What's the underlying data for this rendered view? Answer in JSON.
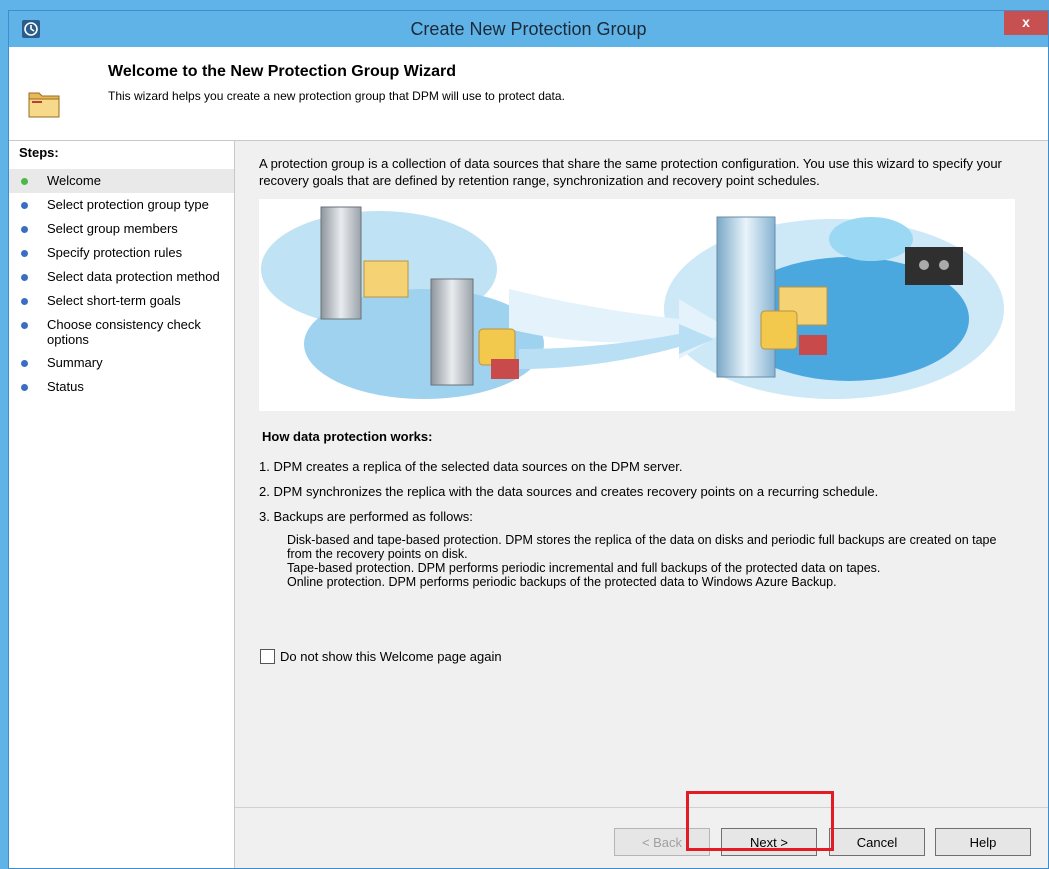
{
  "window": {
    "title": "Create New Protection Group",
    "close_label": "x"
  },
  "header": {
    "title": "Welcome to the New Protection Group Wizard",
    "subtitle": "This wizard helps you create a new protection group that DPM will use to protect data."
  },
  "sidebar": {
    "title": "Steps:",
    "items": [
      {
        "label": "Welcome"
      },
      {
        "label": "Select protection group type"
      },
      {
        "label": "Select group members"
      },
      {
        "label": "Specify protection rules"
      },
      {
        "label": "Select data protection method"
      },
      {
        "label": "Select short-term goals"
      },
      {
        "label": "Choose consistency check options"
      },
      {
        "label": "Summary"
      },
      {
        "label": "Status"
      }
    ],
    "active_index": 0
  },
  "main": {
    "intro": "A protection group is a collection of data sources that share the same protection configuration. You use this wizard to specify your recovery goals that are defined by retention range, synchronization and recovery point schedules.",
    "how_title": "How data protection works:",
    "how_items": [
      "1.  DPM creates a replica of the selected data sources on the DPM server.",
      "2.  DPM synchronizes the replica with the data sources and creates recovery points on a recurring schedule.",
      "3.  Backups are performed as follows:"
    ],
    "backup_details": [
      "Disk-based and tape-based protection. DPM stores the replica of the data on disks and periodic full backups are created on tape from the recovery points on disk.",
      "Tape-based protection. DPM performs periodic incremental and full backups of the protected data on tapes.",
      "Online protection. DPM performs periodic backups of the protected data to Windows Azure Backup."
    ],
    "checkbox_label": "Do not show this Welcome page again",
    "checkbox_checked": false
  },
  "buttons": {
    "back": "< Back",
    "next": "Next >",
    "cancel": "Cancel",
    "help": "Help"
  },
  "colors": {
    "title_bar": "#5fb3e6",
    "active_step_dot": "#4cb848",
    "step_dot": "#3c6dc5",
    "highlight": "#e31b23"
  }
}
